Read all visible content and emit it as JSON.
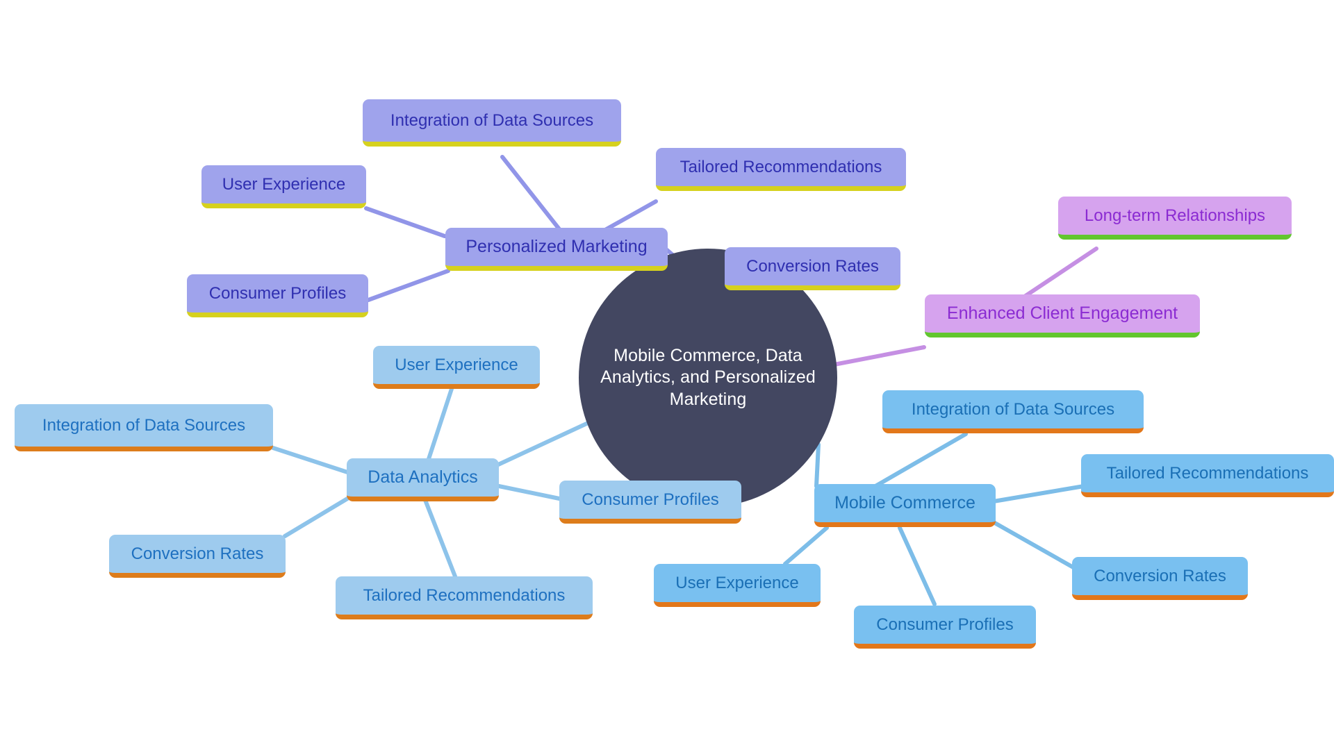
{
  "diagram": {
    "type": "mind-map",
    "background": "#ffffff",
    "central": {
      "text": "Mobile Commerce, Data Analytics, and Personalized Marketing",
      "fill": "#434761",
      "text_color": "#ffffff"
    },
    "branch_palettes": {
      "personalized_marketing": {
        "fill": "#9fa3ec",
        "text": "#2f2fb0",
        "accent": "#d6d11e",
        "edge": "#9195e8"
      },
      "enhanced_client_engagement": {
        "fill": "#d6a3ee",
        "text": "#8b2bd2",
        "accent": "#62c62e",
        "edge": "#c58fe3"
      },
      "data_analytics": {
        "fill": "#9ecbee",
        "text": "#1e70c0",
        "accent": "#dd7c1b",
        "edge": "#8dc3ea"
      },
      "mobile_commerce": {
        "fill": "#79c0f0",
        "text": "#1a6fb5",
        "accent": "#e2771a",
        "edge": "#7dbde8"
      }
    },
    "branches": [
      {
        "id": "personalized-marketing",
        "label": "Personalized Marketing",
        "palette": "personalized_marketing",
        "children": [
          "Integration of Data Sources",
          "User Experience",
          "Consumer Profiles",
          "Tailored Recommendations",
          "Conversion Rates"
        ]
      },
      {
        "id": "enhanced-client-engagement",
        "label": "Enhanced Client Engagement",
        "palette": "enhanced_client_engagement",
        "children": [
          "Long-term Relationships"
        ]
      },
      {
        "id": "data-analytics",
        "label": "Data Analytics",
        "palette": "data_analytics",
        "children": [
          "Integration of Data Sources",
          "User Experience",
          "Consumer Profiles",
          "Tailored Recommendations",
          "Conversion Rates"
        ]
      },
      {
        "id": "mobile-commerce",
        "label": "Mobile Commerce",
        "palette": "mobile_commerce",
        "children": [
          "Integration of Data Sources",
          "Tailored Recommendations",
          "Conversion Rates",
          "Consumer Profiles",
          "User Experience"
        ]
      }
    ],
    "nodes": {
      "central": "Mobile Commerce, Data Analytics, and Personalized Marketing",
      "pm_hub": "Personalized Marketing",
      "pm_integration": "Integration of Data Sources",
      "pm_user_experience": "User Experience",
      "pm_consumer_profiles": "Consumer Profiles",
      "pm_tailored": "Tailored Recommendations",
      "pm_conversion": "Conversion Rates",
      "ece_hub": "Enhanced Client Engagement",
      "ece_longterm": "Long-term Relationships",
      "da_hub": "Data Analytics",
      "da_integration": "Integration of Data Sources",
      "da_user_experience": "User Experience",
      "da_consumer_profiles": "Consumer Profiles",
      "da_tailored": "Tailored Recommendations",
      "da_conversion": "Conversion Rates",
      "mc_hub": "Mobile Commerce",
      "mc_integration": "Integration of Data Sources",
      "mc_tailored": "Tailored Recommendations",
      "mc_conversion": "Conversion Rates",
      "mc_consumer_profiles": "Consumer Profiles",
      "mc_user_experience": "User Experience"
    }
  }
}
